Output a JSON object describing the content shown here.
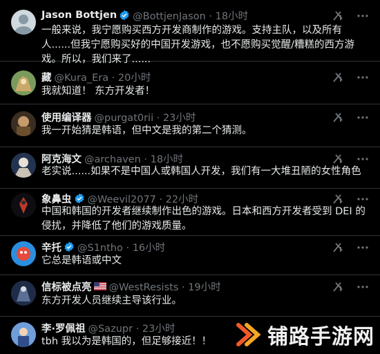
{
  "tweets": [
    {
      "name": "Jason Bottjen",
      "handle": "@BottjenJason · 18小时",
      "verified": true,
      "text": "一般来说，我宁愿购买西方开发商制作的游戏。支持主队，以及所有人......但我宁愿购买好的中国开发游戏，也不愿购买觉醒/糟糕的西方游戏。所以，我们来了......"
    },
    {
      "name": "藏",
      "handle": "@Kura_Era · 20小时",
      "verified": false,
      "text": "我就知道！ 东方开发者！"
    },
    {
      "name": "使用编译器",
      "handle": "@purgat0rii · 23小时",
      "verified": false,
      "text": "我一开始猜是韩语，但中文是我的第二个猜测。"
    },
    {
      "name": "阿克海文",
      "handle": "@archaven · 18小时",
      "verified": false,
      "text": "老实说......如果不是中国人或韩国人开发，我们有一大堆丑陋的女性角色"
    },
    {
      "name": "象鼻虫",
      "handle": "@Weevil2077 · 22小时",
      "verified": true,
      "text": "中国和韩国的开发者继续制作出色的游戏。日本和西方开发者受到 DEI 的侵扰，并降低了他们的游戏质量。"
    },
    {
      "name": "辛托",
      "handle": "@S1ntho · 16小时",
      "verified": true,
      "text": "它总是韩语或中文"
    },
    {
      "name": "信标被点亮",
      "handle": "@WestResists · 19小时",
      "verified": false,
      "flag": "🇺🇸",
      "text": "东方开发人员继续主导该行业。"
    },
    {
      "name": "李·罗佩祖",
      "handle": "@Sazupr · 23小时",
      "verified": false,
      "text": "tbh 我以为是韩国的，但足够接近！！"
    }
  ],
  "watermark": {
    "text": "铺路手游网",
    "logo_color": "#f05a28"
  },
  "colors": {
    "background": "#000000",
    "text": "#e7e9ea",
    "secondary": "#71767b",
    "verified": "#1d9bf0",
    "divider": "#2f3336"
  }
}
